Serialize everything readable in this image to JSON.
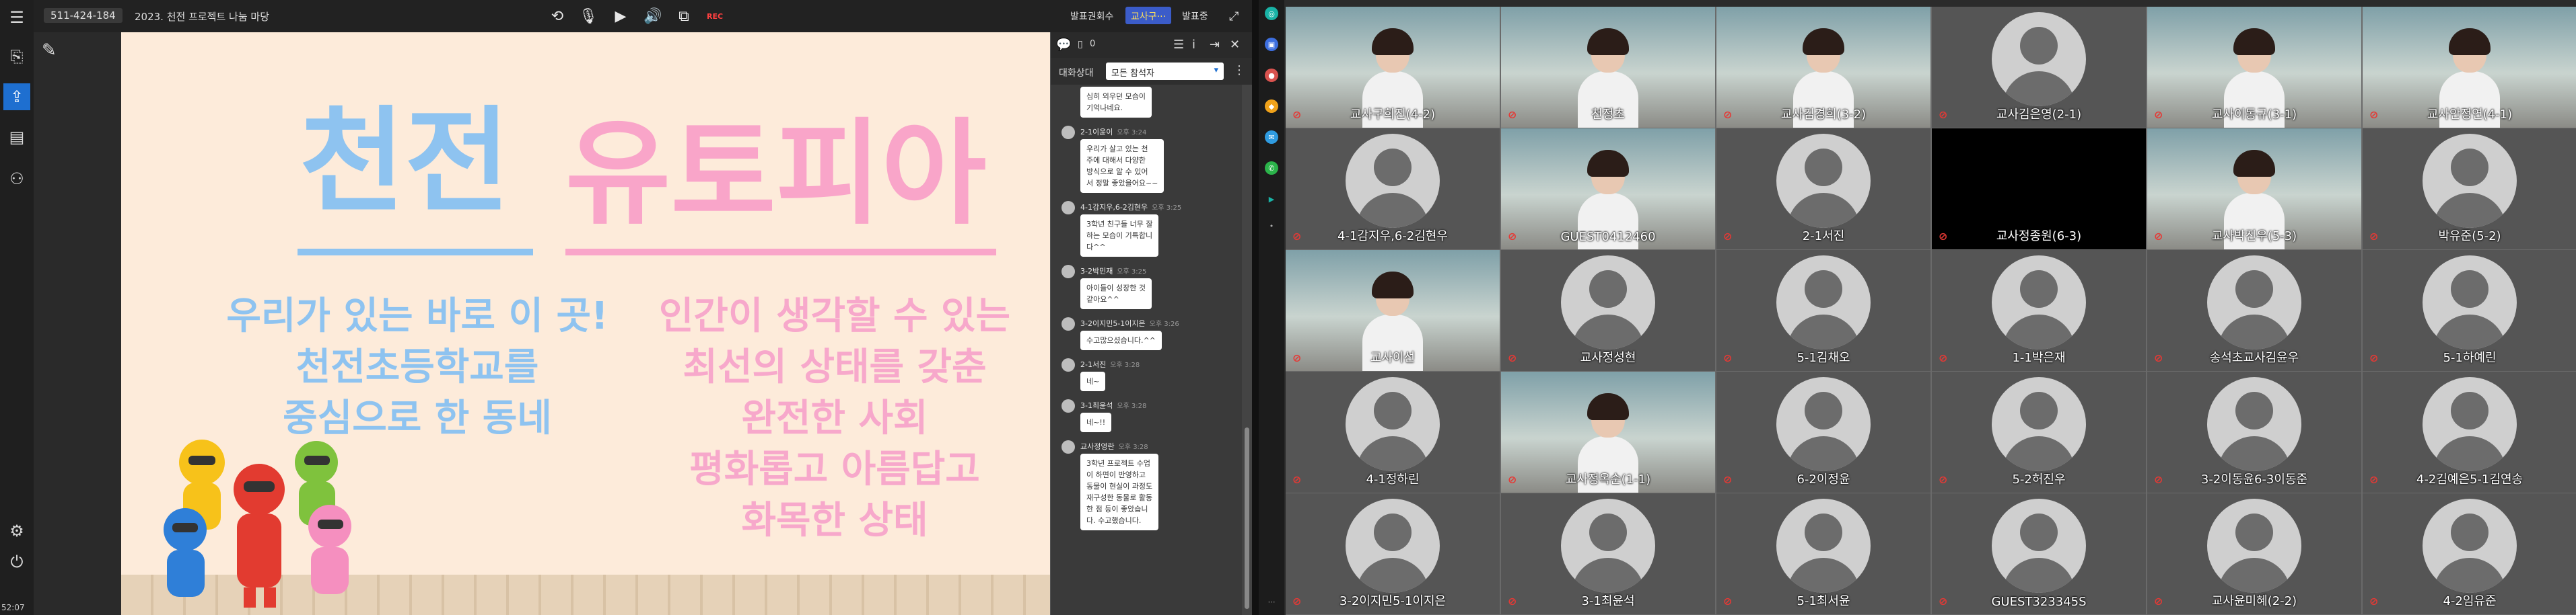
{
  "app": {
    "meeting_id": "511-424-184",
    "meeting_title": "2023. 천전 프로젝트 나눔 마당",
    "rec_label": "REC",
    "clock": "52:07"
  },
  "right_toolbar": {
    "btn1": "발표권회수",
    "btn2": "교사구···",
    "btn3": "발표중"
  },
  "slide": {
    "title_a": "천전",
    "title_b": "유토피아",
    "left_lines": [
      "우리가 있는 바로 이 곳!",
      "천전초등학교를",
      "중심으로 한 동네"
    ],
    "right_lines": [
      "인간이 생각할 수 있는",
      "최선의 상태를 갖춘",
      "완전한 사회",
      "평화롭고 아름답고",
      "화목한 상태"
    ]
  },
  "chat": {
    "count": "0",
    "filter_label": "대화상대",
    "filter_value": "모든 참석자",
    "messages": [
      {
        "sender": "",
        "time": "",
        "text": "심히 외우던 모습이\n기억나네요."
      },
      {
        "sender": "2-1이윤이",
        "time": "오후 3:24",
        "text": "우리가 살고 있는 천\n주에 대해서 다양한\n방식으로 알 수 있어\n서 정말 좋았을어요~~"
      },
      {
        "sender": "4-1감지우,6-2김현우",
        "time": "오후 3:25",
        "text": "3학년 친구들 너무 잘\n하는 모습이 기특합니\n다^^"
      },
      {
        "sender": "3-2박민재",
        "time": "오후 3:25",
        "text": "아이들이 성장한 것\n같아요^^"
      },
      {
        "sender": "3-2이지민5-1이지은",
        "time": "오후 3:26",
        "text": "수고많으셨습니다.^^"
      },
      {
        "sender": "2-1서진",
        "time": "오후 3:28",
        "text": "네~"
      },
      {
        "sender": "3-1최윤석",
        "time": "오후 3:28",
        "text": "네~!!"
      },
      {
        "sender": "교사정영란",
        "time": "오후 3:28",
        "text": "3학년 프로젝트 수업\n이 하면이 반영하고\n동물이 현실이 과정도\n재구성한 동물로 활동\n한 점 등이 좋았습니\n다. 수고했습니다."
      }
    ]
  },
  "participants": [
    {
      "name": "교사구희진(4-2)",
      "type": "video"
    },
    {
      "name": "천정초",
      "type": "video"
    },
    {
      "name": "교사김경희(3-2)",
      "type": "video"
    },
    {
      "name": "교사김은영(2-1)",
      "type": "avatar"
    },
    {
      "name": "교사이동규(3-1)",
      "type": "video"
    },
    {
      "name": "교사안정연(4-1)",
      "type": "video"
    },
    {
      "name": "4-1감지우,6-2김현우",
      "type": "avatar"
    },
    {
      "name": "GUEST0412460",
      "type": "video"
    },
    {
      "name": "2-1서진",
      "type": "avatar"
    },
    {
      "name": "교사정종원(6-3)",
      "type": "black"
    },
    {
      "name": "교사박진우(5-3)",
      "type": "video"
    },
    {
      "name": "박유준(5-2)",
      "type": "avatar"
    },
    {
      "name": "교사이선",
      "type": "video"
    },
    {
      "name": "교사정성현",
      "type": "avatar"
    },
    {
      "name": "5-1김채오",
      "type": "avatar"
    },
    {
      "name": "1-1박은재",
      "type": "avatar"
    },
    {
      "name": "송석초교사김윤우",
      "type": "avatar"
    },
    {
      "name": "5-1하예린",
      "type": "avatar"
    },
    {
      "name": "4-1정하린",
      "type": "avatar"
    },
    {
      "name": "교사정옥순(1-1)",
      "type": "video"
    },
    {
      "name": "6-2이정윤",
      "type": "avatar"
    },
    {
      "name": "5-2허진우",
      "type": "avatar"
    },
    {
      "name": "3-2이동윤6-3이동준",
      "type": "avatar"
    },
    {
      "name": "4-2김예은5-1김연송",
      "type": "avatar"
    },
    {
      "name": "3-2이지민5-1이지은",
      "type": "avatar"
    },
    {
      "name": "3-1최윤석",
      "type": "avatar"
    },
    {
      "name": "5-1최서윤",
      "type": "avatar"
    },
    {
      "name": "GUEST323345S",
      "type": "avatar"
    },
    {
      "name": "교사윤미혜(2-2)",
      "type": "avatar"
    },
    {
      "name": "4-2임유준",
      "type": "avatar"
    }
  ],
  "icons": {
    "rail": [
      "menu-icon",
      "share-content-icon",
      "share-screen-icon",
      "document-icon",
      "org-chart-icon",
      "settings-sliders-icon",
      "exit-icon"
    ],
    "toolbar": [
      "switch-camera-icon",
      "mic-muted-icon",
      "video-icon",
      "speaker-icon",
      "screen-share-icon",
      "record-icon"
    ]
  },
  "colors": {
    "title_blue": "#8ec3f0",
    "title_pink": "#f9a5c9",
    "accent_blue": "#1e6fd0",
    "mic_muted": "#e53935"
  }
}
